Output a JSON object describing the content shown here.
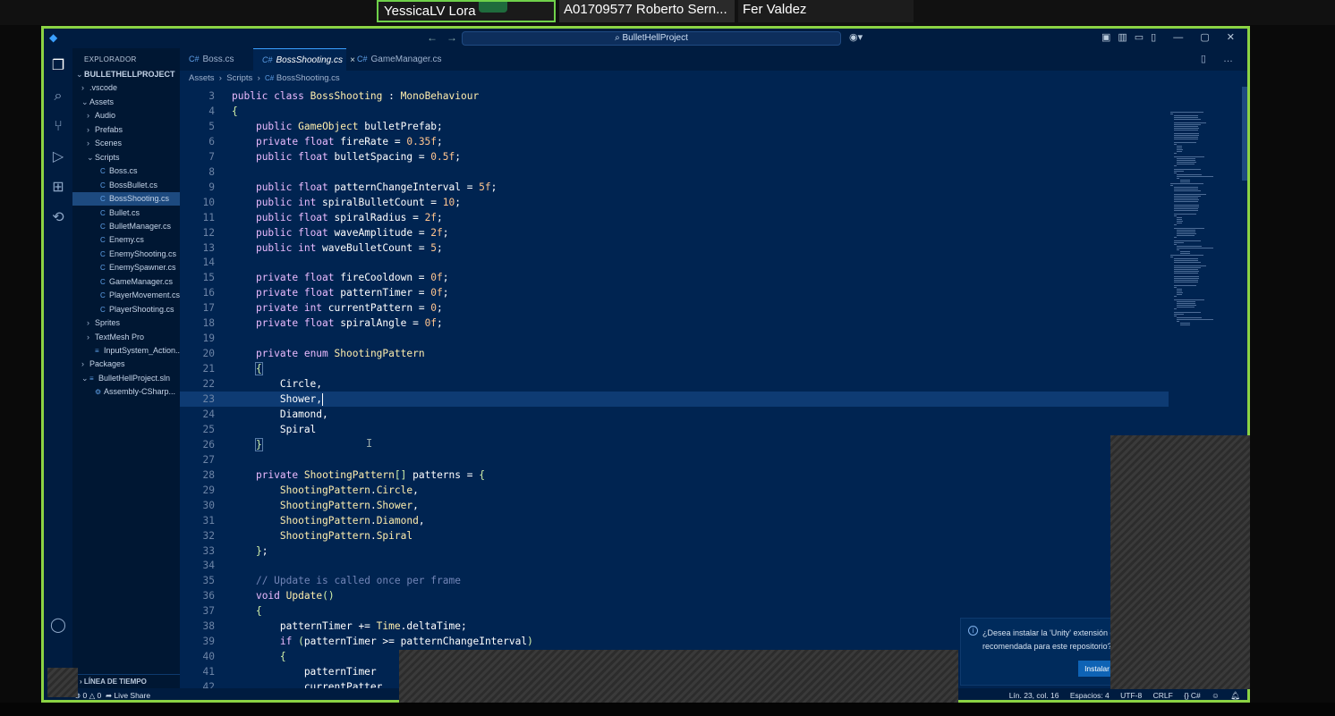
{
  "meeting": {
    "participants": [
      "YessicaLV Lora",
      "A01709577 Roberto Sern...",
      "Fer Valdez"
    ]
  },
  "window": {
    "search": "BulletHellProject"
  },
  "sidebar": {
    "title": "EXPLORADOR",
    "items": [
      {
        "label": "BULLETHELLPROJECT",
        "indent": 0,
        "chev": "⌄",
        "bold": true
      },
      {
        "label": ".vscode",
        "indent": 1,
        "chev": "›"
      },
      {
        "label": "Assets",
        "indent": 1,
        "chev": "⌄"
      },
      {
        "label": "Audio",
        "indent": 2,
        "chev": "›"
      },
      {
        "label": "Prefabs",
        "indent": 2,
        "chev": "›"
      },
      {
        "label": "Scenes",
        "indent": 2,
        "chev": "›"
      },
      {
        "label": "Scripts",
        "indent": 2,
        "chev": "⌄"
      },
      {
        "label": "Boss.cs",
        "indent": 3,
        "file": "C#"
      },
      {
        "label": "BossBullet.cs",
        "indent": 3,
        "file": "C#"
      },
      {
        "label": "BossShooting.cs",
        "indent": 3,
        "file": "C#",
        "selected": true
      },
      {
        "label": "Bullet.cs",
        "indent": 3,
        "file": "C#"
      },
      {
        "label": "BulletManager.cs",
        "indent": 3,
        "file": "C#"
      },
      {
        "label": "Enemy.cs",
        "indent": 3,
        "file": "C#"
      },
      {
        "label": "EnemyShooting.cs",
        "indent": 3,
        "file": "C#"
      },
      {
        "label": "EnemySpawner.cs",
        "indent": 3,
        "file": "C#"
      },
      {
        "label": "GameManager.cs",
        "indent": 3,
        "file": "C#"
      },
      {
        "label": "PlayerMovement.cs",
        "indent": 3,
        "file": "C#"
      },
      {
        "label": "PlayerShooting.cs",
        "indent": 3,
        "file": "C#"
      },
      {
        "label": "Sprites",
        "indent": 2,
        "chev": "›"
      },
      {
        "label": "TextMesh Pro",
        "indent": 2,
        "chev": "›"
      },
      {
        "label": "InputSystem_Action...",
        "indent": 2,
        "file": "≡"
      },
      {
        "label": "Packages",
        "indent": 1,
        "chev": "›"
      },
      {
        "label": "BulletHellProject.sln",
        "indent": 1,
        "chev": "⌄",
        "file": "≡"
      },
      {
        "label": "Assembly-CSharp...",
        "indent": 2,
        "file": "⚙"
      }
    ],
    "timeline": "LÍNEA DE TIEMPO"
  },
  "tabs": [
    {
      "label": "Boss.cs",
      "active": false
    },
    {
      "label": "BossShooting.cs",
      "active": true
    },
    {
      "label": "GameManager.cs",
      "active": false
    }
  ],
  "breadcrumb": [
    "Assets",
    "Scripts",
    "BossShooting.cs"
  ],
  "code_lines": [
    {
      "n": "3",
      "html": "<span class='kw'>public class</span> <span class='ty'>BossShooting</span> : <span class='ty'>MonoBehaviour</span>"
    },
    {
      "n": "4",
      "html": "<span class='br'>{</span>"
    },
    {
      "n": "5",
      "html": "    <span class='kw'>public</span> <span class='ty'>GameObject</span> bulletPrefab;"
    },
    {
      "n": "6",
      "html": "    <span class='kw'>private float</span> fireRate = <span class='num'>0.35f</span>;"
    },
    {
      "n": "7",
      "html": "    <span class='kw'>public float</span> bulletSpacing = <span class='num'>0.5f</span>;"
    },
    {
      "n": "8",
      "html": ""
    },
    {
      "n": "9",
      "html": "    <span class='kw'>public float</span> patternChangeInterval = <span class='num'>5f</span>;"
    },
    {
      "n": "10",
      "html": "    <span class='kw'>public int</span> spiralBulletCount = <span class='num'>10</span>;"
    },
    {
      "n": "11",
      "html": "    <span class='kw'>public float</span> spiralRadius = <span class='num'>2f</span>;"
    },
    {
      "n": "12",
      "html": "    <span class='kw'>public float</span> waveAmplitude = <span class='num'>2f</span>;"
    },
    {
      "n": "13",
      "html": "    <span class='kw'>public int</span> waveBulletCount = <span class='num'>5</span>;"
    },
    {
      "n": "14",
      "html": ""
    },
    {
      "n": "15",
      "html": "    <span class='kw'>private float</span> fireCooldown = <span class='num'>0f</span>;"
    },
    {
      "n": "16",
      "html": "    <span class='kw'>private float</span> patternTimer = <span class='num'>0f</span>;"
    },
    {
      "n": "17",
      "html": "    <span class='kw'>private int</span> currentPattern = <span class='num'>0</span>;"
    },
    {
      "n": "18",
      "html": "    <span class='kw'>private float</span> spiralAngle = <span class='num'>0f</span>;"
    },
    {
      "n": "19",
      "html": ""
    },
    {
      "n": "20",
      "html": "    <span class='kw'>private enum</span> <span class='ty'>ShootingPattern</span>"
    },
    {
      "n": "21",
      "html": "    <span class='br bracket-hl'>{</span>"
    },
    {
      "n": "22",
      "html": "        Circle,"
    },
    {
      "n": "23",
      "html": "        Shower,<span class='cursor'></span>",
      "cur": true
    },
    {
      "n": "24",
      "html": "        Diamond,"
    },
    {
      "n": "25",
      "html": "        Spiral"
    },
    {
      "n": "26",
      "html": "    <span class='br bracket-hl'>}</span>"
    },
    {
      "n": "27",
      "html": ""
    },
    {
      "n": "28",
      "html": "    <span class='kw'>private</span> <span class='ty'>ShootingPattern</span><span class='br'>[]</span> patterns = <span class='br'>{</span>"
    },
    {
      "n": "29",
      "html": "        <span class='ty'>ShootingPattern</span>.<span class='en'>Circle</span>,"
    },
    {
      "n": "30",
      "html": "        <span class='ty'>ShootingPattern</span>.<span class='en'>Shower</span>,"
    },
    {
      "n": "31",
      "html": "        <span class='ty'>ShootingPattern</span>.<span class='en'>Diamond</span>,"
    },
    {
      "n": "32",
      "html": "        <span class='ty'>ShootingPattern</span>.<span class='en'>Spiral</span>"
    },
    {
      "n": "33",
      "html": "    <span class='br'>}</span>;"
    },
    {
      "n": "34",
      "html": ""
    },
    {
      "n": "35",
      "html": "    <span class='cm'>// Update is called once per frame</span>"
    },
    {
      "n": "36",
      "html": "    <span class='kw'>void</span> <span class='ty'>Update</span><span class='br'>()</span>"
    },
    {
      "n": "37",
      "html": "    <span class='br'>{</span>"
    },
    {
      "n": "38",
      "html": "        patternTimer += <span class='ty'>Time</span>.deltaTime;"
    },
    {
      "n": "39",
      "html": "        <span class='kw'>if</span> <span class='br'>(</span>patternTimer &gt;= patternChangeInterval<span class='br'>)</span>"
    },
    {
      "n": "40",
      "html": "        <span class='br'>{</span>"
    },
    {
      "n": "41",
      "html": "            patternTimer"
    },
    {
      "n": "42",
      "html": "            currentPatter"
    }
  ],
  "notification": {
    "message_line1": "¿Desea instalar la 'Unity' extensión d",
    "message_line2": "recomendada para este repositorio?",
    "install_label": "Instalar"
  },
  "statusbar": {
    "errors": "0",
    "warnings": "0",
    "live_share": "Live Share",
    "position": "Lín. 23, col. 16",
    "spaces": "Espacios: 4",
    "encoding": "UTF-8",
    "eol": "CRLF",
    "language": "C#"
  }
}
